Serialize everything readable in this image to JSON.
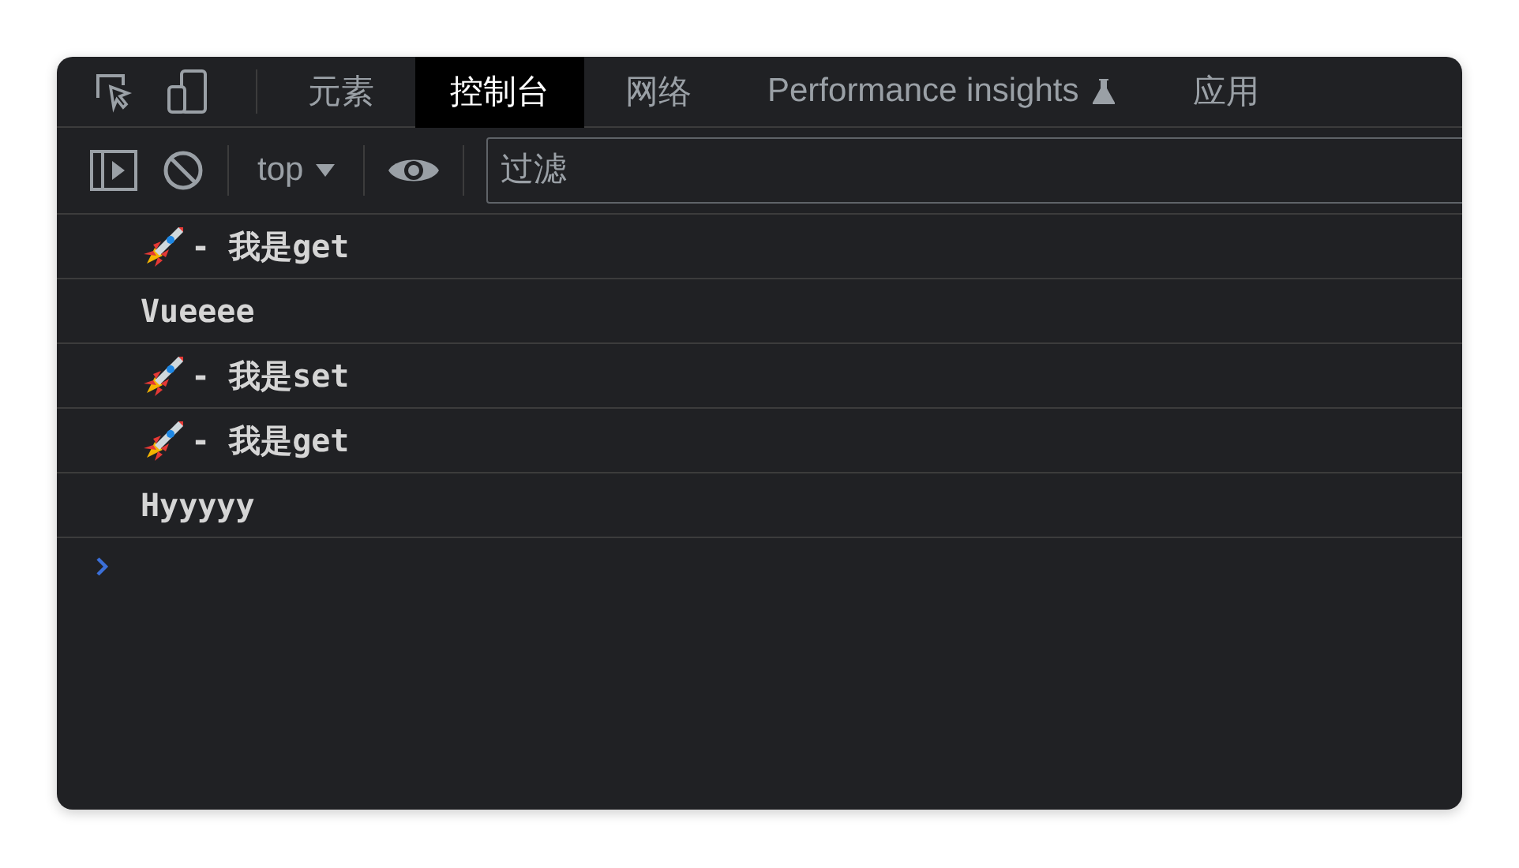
{
  "tabs": [
    {
      "label": "元素",
      "selected": false,
      "kind": "plain"
    },
    {
      "label": "控制台",
      "selected": true,
      "kind": "plain"
    },
    {
      "label": "网络",
      "selected": false,
      "kind": "plain"
    },
    {
      "label": "Performance insights",
      "selected": false,
      "kind": "experimental"
    },
    {
      "label": "应用",
      "selected": false,
      "kind": "plain"
    }
  ],
  "toolbar": {
    "context": "top",
    "filter": {
      "placeholder": "过滤"
    }
  },
  "messages": [
    {
      "kind": "rocket",
      "text": "- 我是get"
    },
    {
      "kind": "plain",
      "text": "Vueeee"
    },
    {
      "kind": "rocket",
      "text": "- 我是set"
    },
    {
      "kind": "rocket",
      "text": "- 我是get"
    },
    {
      "kind": "plain",
      "text": "Hyyyyy"
    }
  ]
}
